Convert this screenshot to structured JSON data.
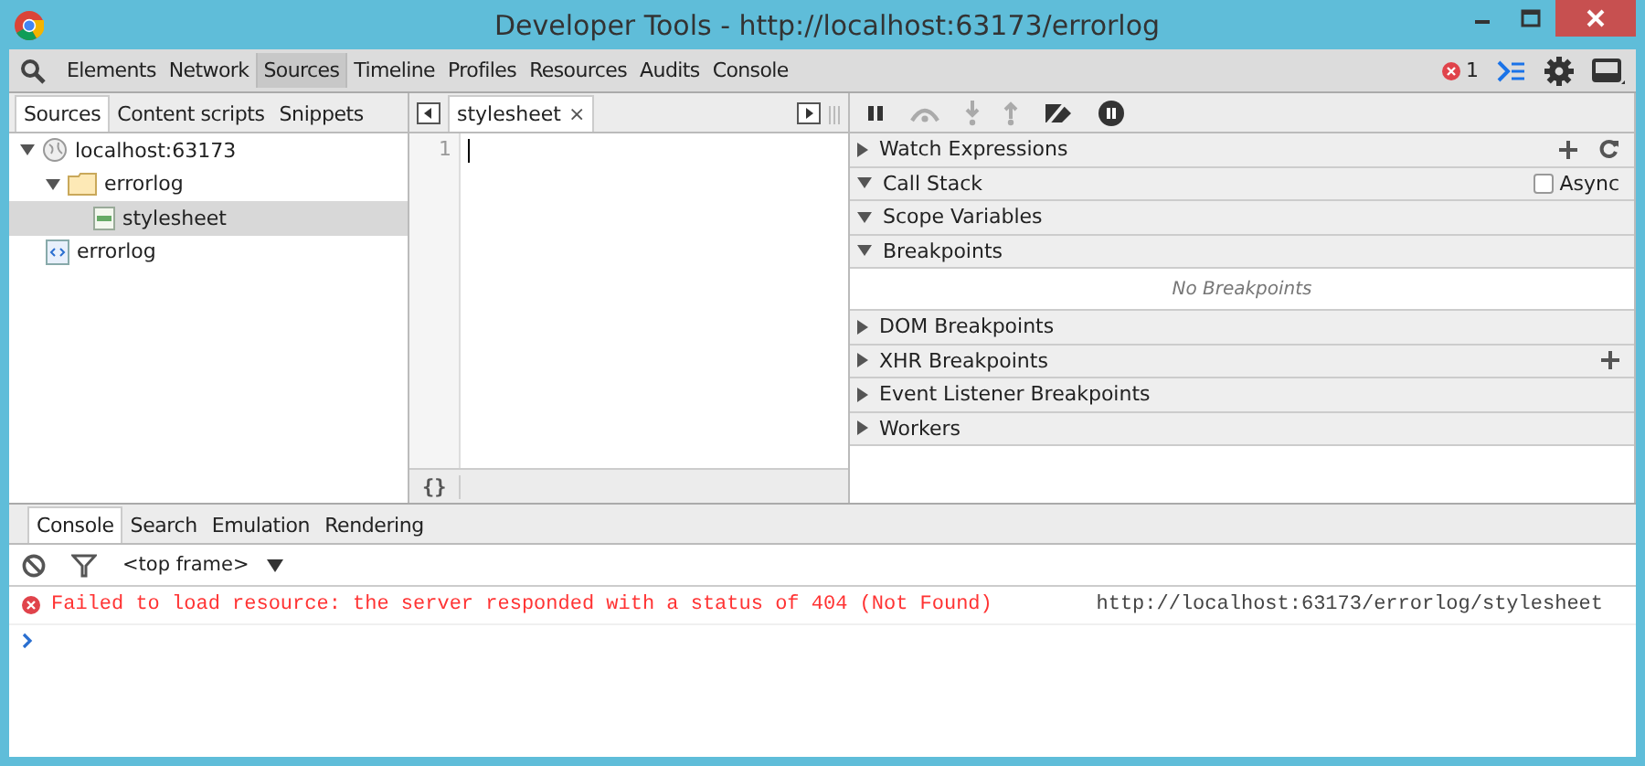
{
  "window": {
    "title": "Developer Tools - http://localhost:63173/errorlog"
  },
  "toolbar": {
    "tabs": [
      {
        "label": "Elements",
        "selected": false
      },
      {
        "label": "Network",
        "selected": false
      },
      {
        "label": "Sources",
        "selected": true
      },
      {
        "label": "Timeline",
        "selected": false
      },
      {
        "label": "Profiles",
        "selected": false
      },
      {
        "label": "Resources",
        "selected": false
      },
      {
        "label": "Audits",
        "selected": false
      },
      {
        "label": "Console",
        "selected": false
      }
    ],
    "error_count": "1"
  },
  "navigator": {
    "tabs": [
      {
        "label": "Sources",
        "selected": true
      },
      {
        "label": "Content scripts",
        "selected": false
      },
      {
        "label": "Snippets",
        "selected": false
      }
    ],
    "tree": [
      {
        "label": "localhost:63173",
        "kind": "domain",
        "expanded": true,
        "selected": false,
        "children": [
          {
            "label": "errorlog",
            "kind": "folder",
            "expanded": true,
            "selected": false,
            "children": [
              {
                "label": "stylesheet",
                "kind": "stylesheet",
                "selected": true
              }
            ]
          },
          {
            "label": "errorlog",
            "kind": "document",
            "selected": false
          }
        ]
      }
    ]
  },
  "editor": {
    "tab": {
      "label": "stylesheet",
      "close": "×"
    },
    "line_numbers": [
      "1"
    ],
    "format_button": "{}"
  },
  "debugger": {
    "sections": [
      {
        "title": "Watch Expressions",
        "expanded": false,
        "actions": [
          {
            "kind": "add"
          },
          {
            "kind": "refresh"
          }
        ]
      },
      {
        "title": "Call Stack",
        "expanded": true,
        "checkbox": {
          "label": "Async",
          "checked": false
        }
      },
      {
        "title": "Scope Variables",
        "expanded": true
      },
      {
        "title": "Breakpoints",
        "expanded": true,
        "message": "No Breakpoints"
      },
      {
        "title": "DOM Breakpoints",
        "expanded": false
      },
      {
        "title": "XHR Breakpoints",
        "expanded": false,
        "actions": [
          {
            "kind": "add"
          }
        ]
      },
      {
        "title": "Event Listener Breakpoints",
        "expanded": false
      },
      {
        "title": "Workers",
        "expanded": false
      }
    ]
  },
  "drawer": {
    "tabs": [
      {
        "label": "Console",
        "selected": true
      },
      {
        "label": "Search",
        "selected": false
      },
      {
        "label": "Emulation",
        "selected": false
      },
      {
        "label": "Rendering",
        "selected": false
      }
    ],
    "frame": "<top frame>",
    "messages": [
      {
        "kind": "error",
        "text": "Failed to load resource: the server responded with a status of 404 (Not Found)",
        "source": "http://localhost:63173/errorlog/stylesheet"
      }
    ]
  }
}
